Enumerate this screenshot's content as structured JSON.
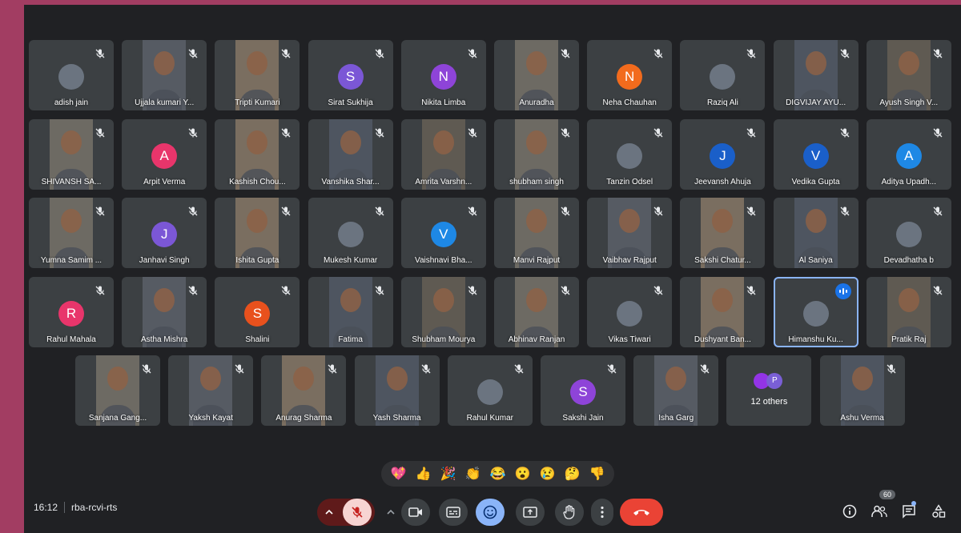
{
  "meeting": {
    "time": "16:12",
    "code": "rba-rcvi-rts",
    "participant_count": "60"
  },
  "tiles": [
    {
      "name": "adish jain",
      "type": "photo"
    },
    {
      "name": "Ujjala kumari Y...",
      "type": "video"
    },
    {
      "name": "Tripti Kumari",
      "type": "video"
    },
    {
      "name": "Sirat Sukhija",
      "type": "letter",
      "letter": "S",
      "color": "#7b57d6"
    },
    {
      "name": "Nikita Limba",
      "type": "letter",
      "letter": "N",
      "color": "#8e44d8"
    },
    {
      "name": "Anuradha",
      "type": "video"
    },
    {
      "name": "Neha Chauhan",
      "type": "letter",
      "letter": "N",
      "color": "#f26b1d"
    },
    {
      "name": "Raziq Ali",
      "type": "photo"
    },
    {
      "name": "DIGVIJAY AYU...",
      "type": "video"
    },
    {
      "name": "Ayush Singh V...",
      "type": "video"
    },
    {
      "name": "SHIVANSH SA...",
      "type": "video"
    },
    {
      "name": "Arpit Verma",
      "type": "letter",
      "letter": "A",
      "color": "#e8356b"
    },
    {
      "name": "Kashish Chou...",
      "type": "video"
    },
    {
      "name": "Vanshika Shar...",
      "type": "video"
    },
    {
      "name": "Amrita Varshn...",
      "type": "video"
    },
    {
      "name": "shubham singh",
      "type": "video"
    },
    {
      "name": "Tanzin Odsel",
      "type": "photo"
    },
    {
      "name": "Jeevansh Ahuja",
      "type": "letter",
      "letter": "J",
      "color": "#1a5fc9"
    },
    {
      "name": "Vedika Gupta",
      "type": "letter",
      "letter": "V",
      "color": "#1a5fc9"
    },
    {
      "name": "Aditya Upadh...",
      "type": "letter",
      "letter": "A",
      "color": "#1e88e5"
    },
    {
      "name": "Yumna Samim ...",
      "type": "video"
    },
    {
      "name": "Janhavi Singh",
      "type": "letter",
      "letter": "J",
      "color": "#7b57d6"
    },
    {
      "name": "Ishita Gupta",
      "type": "video"
    },
    {
      "name": "Mukesh Kumar",
      "type": "photo"
    },
    {
      "name": "Vaishnavi Bha...",
      "type": "letter",
      "letter": "V",
      "color": "#1e88e5"
    },
    {
      "name": "Manvi Rajput",
      "type": "video"
    },
    {
      "name": "Vaibhav Rajput",
      "type": "video"
    },
    {
      "name": "Sakshi Chatur...",
      "type": "video"
    },
    {
      "name": "Al Saniya",
      "type": "video"
    },
    {
      "name": "Devadhatha b",
      "type": "photo"
    },
    {
      "name": "Rahul Mahala",
      "type": "letter",
      "letter": "R",
      "color": "#e8356b"
    },
    {
      "name": "Astha Mishra",
      "type": "video"
    },
    {
      "name": "Shalini",
      "type": "letter",
      "letter": "S",
      "color": "#e8511d"
    },
    {
      "name": "Fatima",
      "type": "video"
    },
    {
      "name": "Shubham Mourya",
      "type": "video"
    },
    {
      "name": "Abhinav Ranjan",
      "type": "video"
    },
    {
      "name": "Vikas Tiwari",
      "type": "photo"
    },
    {
      "name": "Dushyant Ban...",
      "type": "video"
    },
    {
      "name": "Himanshu Ku...",
      "type": "photo",
      "speaking": true
    },
    {
      "name": "Pratik Raj",
      "type": "video"
    },
    {
      "name": "Sanjana Gang...",
      "type": "video"
    },
    {
      "name": "Yaksh Kayat",
      "type": "video"
    },
    {
      "name": "Anurag Sharma",
      "type": "video"
    },
    {
      "name": "Yash Sharma",
      "type": "video"
    },
    {
      "name": "Rahul Kumar",
      "type": "photo"
    },
    {
      "name": "Sakshi Jain",
      "type": "letter",
      "letter": "S",
      "color": "#8e44d8"
    },
    {
      "name": "Isha Garg",
      "type": "video"
    },
    {
      "name": "12 others",
      "type": "others",
      "letter": "P"
    },
    {
      "name": "Ashu Verma",
      "type": "video"
    }
  ],
  "reactions": [
    "💖",
    "👍",
    "🎉",
    "👏",
    "😂",
    "😮",
    "😢",
    "🤔",
    "👎"
  ],
  "toolbar": {
    "mic_icon": "mic-off-icon",
    "camera_icon": "camera-icon",
    "captions_icon": "captions-icon",
    "reactions_icon": "emoji-icon",
    "present_icon": "present-icon",
    "hand_icon": "raise-hand-icon",
    "more_icon": "more-vert-icon",
    "hangup_icon": "hangup-icon",
    "info_icon": "info-icon",
    "people_icon": "people-icon",
    "chat_icon": "chat-icon",
    "activities_icon": "activities-icon"
  }
}
